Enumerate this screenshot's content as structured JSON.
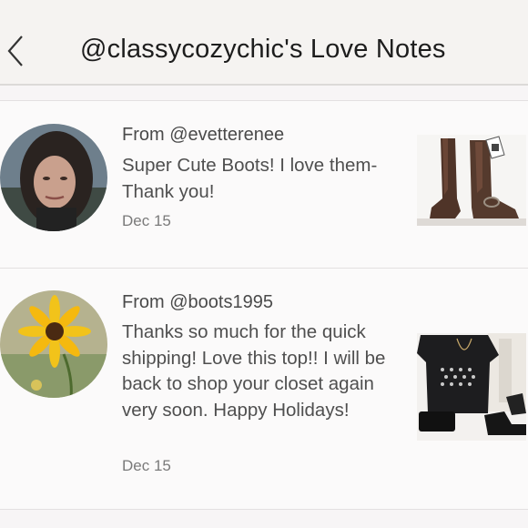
{
  "header": {
    "title": "@classycozychic's Love Notes",
    "back_icon": "chevron-left-icon"
  },
  "notes": [
    {
      "from": "From @evetterenee",
      "message": "Super Cute Boots! I love them- Thank you!",
      "date": "Dec 15",
      "thumbnail": "brown riding boots"
    },
    {
      "from": "From @boots1995",
      "message": "Thanks so much for the quick shipping! Love this top!! I will be back to shop your closet again very soon.  Happy Holidays!",
      "date": "Dec 15",
      "thumbnail": "black star print top outfit"
    }
  ],
  "colors": {
    "header_bg": "#f5f3f1",
    "page_bg": "#f7f5f6",
    "text_primary": "#4a4a4a",
    "text_muted": "#7a7a7a"
  }
}
